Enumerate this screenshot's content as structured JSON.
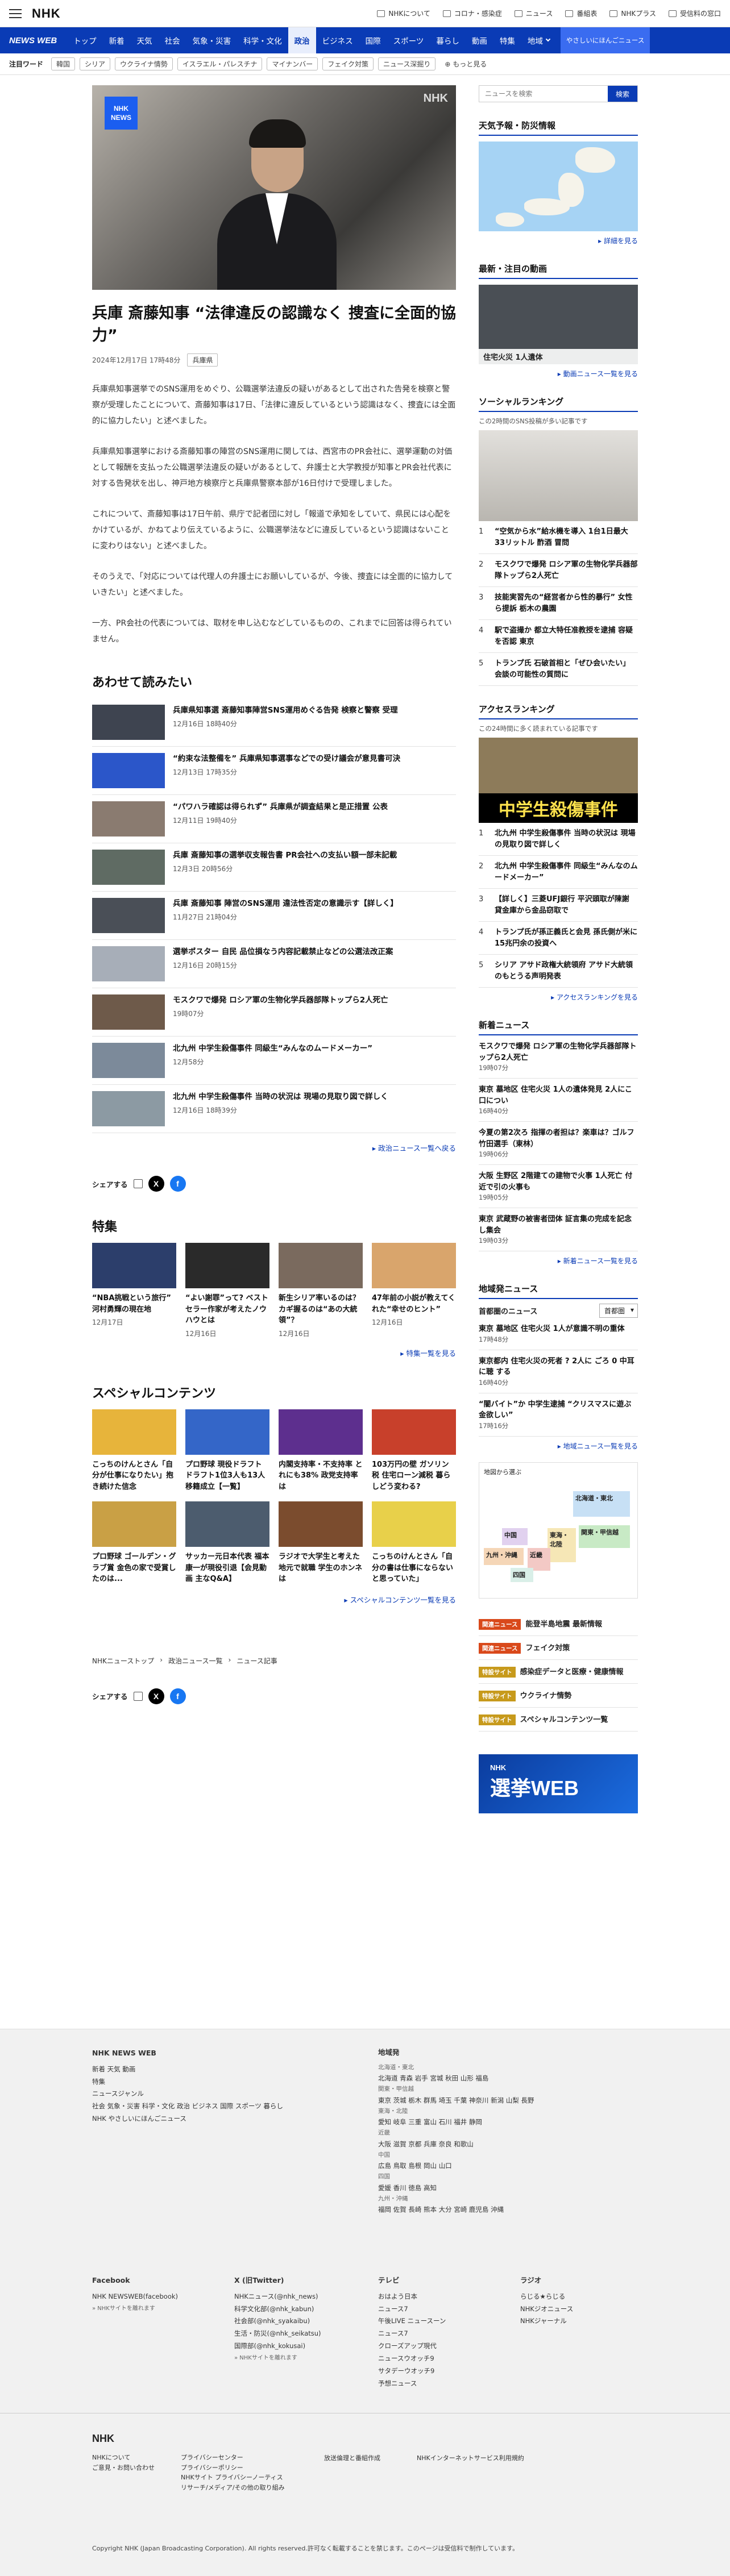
{
  "header": {
    "logo": "NHK",
    "links": [
      "NHKについて",
      "コロナ・感染症",
      "ニュース",
      "番組表",
      "NHKプラス",
      "受信料の窓口"
    ]
  },
  "nav": {
    "brand": "NEWS WEB",
    "items": [
      "トップ",
      "新着",
      "天気",
      "社会",
      "気象・災害",
      "科学・文化",
      "政治",
      "ビジネス",
      "国際",
      "スポーツ",
      "暮らし",
      "動画",
      "特集",
      "地域"
    ],
    "active": "政治",
    "easy": "やさしいにほんごニュース"
  },
  "trend": {
    "title": "注目ワード",
    "tags": [
      "韓国",
      "シリア",
      "ウクライナ情勢",
      "イスラエル・パレスチナ",
      "マイナンバー",
      "フェイク対策",
      "ニュース深掘り"
    ],
    "more": "もっと見る"
  },
  "article": {
    "badge": "NHK NEWS",
    "watermark": "NHK",
    "title": "兵庫 斎藤知事 “法律違反の認識なく 捜査に全面的協力”",
    "date": "2024年12月17日 17時48分",
    "category": "兵庫県",
    "paragraphs": [
      "兵庫県知事選挙でのSNS運用をめぐり、公職選挙法違反の疑いがあるとして出された告発を検察と警察が受理したことについて、斎藤知事は17日、「法律に違反しているという認識はなく、捜査には全面的に協力したい」と述べました。",
      "兵庫県知事選挙における斎藤知事の陣営のSNS運用に関しては、西宮市のPR会社に、選挙運動の対価として報酬を支払った公職選挙法違反の疑いがあるとして、弁護士と大学教授が知事とPR会社代表に対する告発状を出し、神戸地方検察庁と兵庫県警察本部が16日付けで受理しました。",
      "これについて、斎藤知事は17日午前、県庁で記者団に対し「報道で承知をしていて、県民には心配をかけているが、かねてより伝えているように、公職選挙法などに違反しているという認識はないことに変わりはない」と述べました。",
      "そのうえで、「対応については代理人の弁護士にお願いしているが、今後、捜査には全面的に協力していきたい」と述べました。",
      "一方、PR会社の代表については、取材を申し込むなどしているものの、これまでに回答は得られていません。"
    ]
  },
  "related": {
    "title": "あわせて読みたい",
    "items": [
      {
        "title": "兵庫県知事選 斎藤知事陣営SNS運用めぐる告発 検察と警察 受理",
        "date": "12月16日 18時40分"
      },
      {
        "title": "“約束な法整備を” 兵庫県知事選事などでの受け議会が意見書可決",
        "date": "12月13日 17時35分"
      },
      {
        "title": "“パワハラ確認は得られず” 兵庫県が調査結果と是正措置 公表",
        "date": "12月11日 19時40分"
      },
      {
        "title": "兵庫 斎藤知事の選挙収支報告書 PR会社への支払い額一部未記載",
        "date": "12月3日 20時56分"
      },
      {
        "title": "兵庫 斎藤知事 陣営のSNS運用 違法性否定の意識示す【詳しく】",
        "date": "11月27日 21時04分"
      },
      {
        "title": "選挙ポスター 自民 品位損なう内容記載禁止などの公選法改正案",
        "date": "12月16日 20時15分"
      },
      {
        "title": "モスクワで爆発 ロシア軍の生物化学兵器部隊トップら2人死亡",
        "date": "19時07分"
      },
      {
        "title": "北九州 中学生殺傷事件 同級生“みんなのムードメーカー”",
        "date": "12月58分"
      },
      {
        "title": "北九州 中学生殺傷事件 当時の状況は 現場の見取り図で詳しく",
        "date": "12月16日 18時39分"
      }
    ],
    "more": "政治ニュース一覧へ戻る"
  },
  "share": {
    "label": "シェアする"
  },
  "features": {
    "title": "特集",
    "items": [
      {
        "title": "“NBA挑戦という旅行” 河村勇輝の現在地",
        "date": "12月17日"
      },
      {
        "title": "“よい謝罪”って? ベストセラー作家が考えたノウハウとは",
        "date": "12月16日"
      },
      {
        "title": "新生シリア率いるのは？カギ握るのは“あの大統領”？",
        "date": "12月16日"
      },
      {
        "title": "47年前の小説が教えてくれた“幸せのヒント”",
        "date": "12月16日"
      }
    ],
    "more": "特集一覧を見る"
  },
  "special": {
    "title": "スペシャルコンテンツ",
    "items": [
      {
        "title": "こっちのけんとさん「自分が仕事になりたい」抱き続けた信念"
      },
      {
        "title": "プロ野球 現役ドラフト ドラフト1位3人も13人移籍成立【一覧】"
      },
      {
        "title": "内閣支持率・不支持率 とれにも38% 政党支持率は"
      },
      {
        "title": "103万円の壁 ガソリン税 住宅ローン減税 暮らしどう変わる?"
      },
      {
        "title": "プロ野球 ゴールデン・グラブ賞 金色の家で受賞したのは..."
      },
      {
        "title": "サッカー元日本代表 福本康一が現役引退【会見動画 主なQ&A】"
      },
      {
        "title": "ラジオで大学生と考えた 地元で就職 学生のホンネは"
      },
      {
        "title": "こっちのけんとさん「自分の書は仕事にならないと思っていた」"
      }
    ],
    "more": "スペシャルコンテンツ一覧を見る"
  },
  "breadcrumb": [
    "NHKニューストップ",
    "政治ニュース一覧",
    "ニュース記事"
  ],
  "sidebar": {
    "search": {
      "placeholder": "ニュースを検索",
      "button": "検索"
    },
    "weather": {
      "title": "天気予報・防災情報",
      "more": "詳細を見る"
    },
    "video": {
      "title": "最新・注目の動画",
      "caption": "住宅火災 1人遺体",
      "more": "動画ニュース一覧を見る"
    },
    "social": {
      "title": "ソーシャルランキング",
      "note": "この2時間のSNS投稿が多い記事です",
      "items": [
        "“空気から水”給水機を導入 1台1日最大33リットル 酢酒 冒問",
        "モスクワで爆発 ロシア軍の生物化学兵器部隊トップら2人死亡",
        "技能実習先の“経営者から性的暴行” 女性ら提訴 栃木の農園",
        "駅で盗撮か 都立大特任准教授を逮捕 容疑を否認 東京",
        "トランプ氏 石破首相と「ぜひ会いたい」 会談の可能性の質問に"
      ]
    },
    "access": {
      "title": "アクセスランキング",
      "note": "この24時間に多く読まれている記事です",
      "caption": "中学生殺傷事件",
      "items": [
        "北九州 中学生殺傷事件 当時の状況は 現場の見取り図で詳しく",
        "北九州 中学生殺傷事件 同級生“みんなのムードメーカー”",
        "【詳しく】三菱UFJ銀行 平沢頭取が陳謝 貸金庫から金品窃取で",
        "トランプ氏が孫正義氏と会見 孫氏側が米に15兆円余の投資へ",
        "シリア アサド政権大統領府 アサド大統領のもとうる声明発表"
      ],
      "more": "アクセスランキングを見る"
    },
    "latest": {
      "title": "新着ニュース",
      "items": [
        {
          "title": "モスクワで爆発 ロシア軍の生物化学兵器部隊トップら2人死亡",
          "date": "19時07分"
        },
        {
          "title": "東京 墓地区 住宅火災 1人の遺体発見 2人にこ 口につい",
          "date": "16時40分"
        },
        {
          "title": "今夏の第2次ろ 指揮の者担は？楽車は？ゴルフ 竹田選手（東林）",
          "date": "19時06分"
        },
        {
          "title": "大阪 生野区 2階建ての建物で火事 1人死亡 付近で引の火事も",
          "date": "19時05分"
        },
        {
          "title": "東京 武蔵野の被害者団体 証言集の完成を記念し集会",
          "date": "19時03分"
        }
      ],
      "more": "新着ニュース一覧を見る"
    },
    "region": {
      "title": "地域発ニュース",
      "sub": "首都圏のニュース",
      "select": "首都圏",
      "items": [
        {
          "title": "東京 墓地区 住宅火災 1人が意識不明の重体",
          "date": "17時48分"
        },
        {
          "title": "東京都内 住宅火災の死者 ? 2人に ごろ 0 中耳に聴 する",
          "date": "16時40分"
        },
        {
          "title": "“闇バイト”か 中学生逮捕 “クリスマスに遊ぶ金欲しい”",
          "date": "17時16分"
        }
      ],
      "more": "地域ニュース一覧を見る"
    },
    "mapnote": "地図から選ぶ",
    "regions": [
      "北海道・東北",
      "関東・甲信越",
      "東海・北陸",
      "近畿",
      "中国",
      "四国",
      "九州・沖縄"
    ],
    "links": [
      {
        "badge": "関連ニュース",
        "text": "能登半島地震 最新情報",
        "color": "#d9491b"
      },
      {
        "badge": "関連ニュース",
        "text": "フェイク対策",
        "color": "#d9491b"
      },
      {
        "badge": "特設サイト",
        "text": "感染症データと医療・健康情報",
        "color": "#c79a1c"
      },
      {
        "badge": "特設サイト",
        "text": "ウクライナ情勢",
        "color": "#c79a1c"
      },
      {
        "badge": "特設サイト",
        "text": "スペシャルコンテンツ一覧",
        "color": "#c79a1c"
      }
    ],
    "banner": "選挙WEB",
    "banner_logo": "NHK"
  },
  "footer": {
    "col1": {
      "title": "NHK NEWS WEB",
      "rows": [
        "新着 天気 動画",
        "特集",
        "ニュースジャンル",
        "社会 気象・災害 科学・文化 政治 ビジネス 国際 スポーツ 暮らし",
        "NHK やさしいにほんごニュース"
      ]
    },
    "col2": {
      "title": "地域発",
      "rows": [
        "北海道・東北",
        "北海道 青森 岩手 宮城 秋田 山形 福島",
        "関東・甲信越",
        "東京 茨城 栃木 群馬 埼玉 千葉 神奈川 新潟 山梨 長野",
        "東海・北陸",
        "愛知 岐阜 三重 富山 石川 福井 静岡",
        "近畿",
        "大阪 滋賀 京都 兵庫 奈良 和歌山",
        "中国",
        "広島 鳥取 島根 岡山 山口",
        "四国",
        "愛媛 香川 徳島 高知",
        "九州・沖縄",
        "福岡 佐賀 長崎 熊本 大分 宮崎 鹿児島 沖縄"
      ]
    },
    "sns": [
      {
        "title": "Facebook",
        "rows": [
          "NHK NEWSWEB(facebook)",
          "» NHKサイトを離れます"
        ]
      },
      {
        "title": "X (旧Twitter)",
        "rows": [
          "NHKニュース(@nhk_news)",
          "科学文化部(@nhk_kabun)",
          "社会部(@nhk_syakaibu)",
          "生活・防災(@nhk_seikatsu)",
          "国際部(@nhk_kokusai)",
          "» NHKサイトを離れます"
        ]
      },
      {
        "title": "テレビ",
        "rows": [
          "おはよう日本",
          "ニュース7",
          "午後LIVE ニュースーン",
          "ニュース7",
          "クローズアップ現代",
          "ニュースウオッチ9",
          "サタデーウオッチ9",
          "予想ニュース"
        ]
      },
      {
        "title": "ラジオ",
        "rows": [
          "らじる★らじる",
          "NHKジオニュース",
          "NHKジャーナル"
        ]
      }
    ],
    "logo": "NHK",
    "bottom": [
      [
        "NHKについて",
        "ご意見・お問い合わせ"
      ],
      [
        "プライバシーセンター",
        "プライバシーポリシー",
        "NHKサイト プライバシーノーティス",
        "リサーチ/メディア/その他の取り組み"
      ],
      [
        "放送倫理と番組作成"
      ],
      [
        "NHKインターネットサービス利用規約"
      ]
    ],
    "copyright": "Copyright NHK (Japan Broadcasting Corporation). All rights reserved.許可なく転載することを禁じます。このページは受信料で制作しています。"
  }
}
